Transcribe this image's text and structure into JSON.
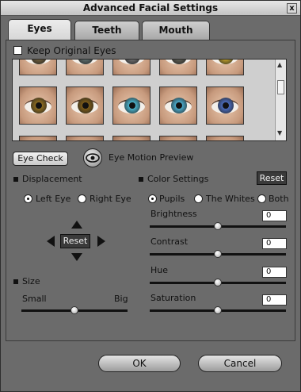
{
  "window": {
    "title": "Advanced Facial Settings",
    "close": "x"
  },
  "tabs": [
    {
      "label": "Eyes",
      "active": true
    },
    {
      "label": "Teeth",
      "active": false
    },
    {
      "label": "Mouth",
      "active": false
    }
  ],
  "keep_original": {
    "label": "Keep Original Eyes",
    "checked": false
  },
  "eye_grid": {
    "rows": [
      [
        "#6a5a3a",
        "#5a6a6a",
        "#6a6a6a",
        "#5a5a50",
        "#b89a2a"
      ],
      [
        "#8a6a20",
        "#7a5a18",
        "#4ab0c8",
        "#4aa8c8",
        "#4a6ab8"
      ],
      [
        "#7a6a50",
        "#8a7050",
        "#6a6a6a",
        "#7a6a5a",
        "#6a5a4a"
      ]
    ]
  },
  "eye_check": {
    "label": "Eye Check"
  },
  "motion_preview": {
    "label": "Eye Motion Preview",
    "icon": "eye-icon"
  },
  "displacement": {
    "title": "Displacement",
    "left_eye": "Left Eye",
    "right_eye": "Right Eye",
    "selected": "Left Eye",
    "reset": "Reset"
  },
  "size": {
    "title": "Size",
    "small": "Small",
    "big": "Big",
    "value": 0.5
  },
  "color_settings": {
    "title": "Color Settings",
    "reset": "Reset",
    "pupils": "Pupils",
    "whites": "The Whites",
    "both": "Both",
    "selected": "Pupils",
    "sliders": [
      {
        "label": "Brightness",
        "value": "0",
        "level": 0.5
      },
      {
        "label": "Contrast",
        "value": "0",
        "level": 0.5
      },
      {
        "label": "Hue",
        "value": "0",
        "level": 0.5
      },
      {
        "label": "Saturation",
        "value": "0",
        "level": 0.5
      }
    ]
  },
  "buttons": {
    "ok": "OK",
    "cancel": "Cancel"
  }
}
